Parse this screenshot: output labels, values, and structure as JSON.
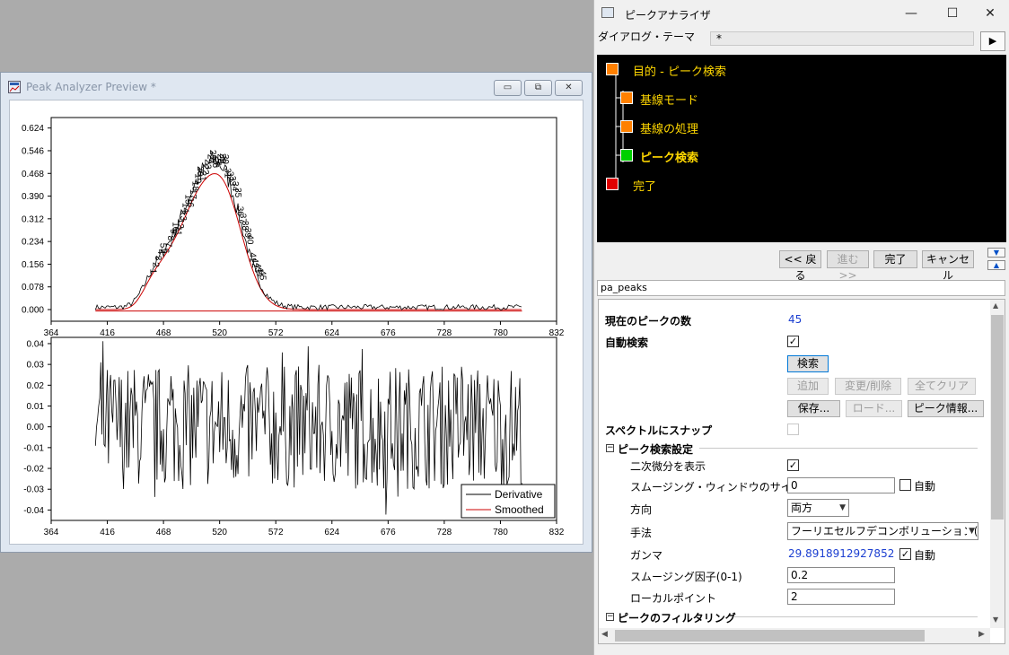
{
  "preview": {
    "title": "Peak Analyzer Preview *",
    "controls": {
      "minimize": "▭",
      "restore": "⧉",
      "close": "✕"
    },
    "top_plot": {
      "x_ticks": [
        "364",
        "416",
        "468",
        "520",
        "572",
        "624",
        "676",
        "728",
        "780",
        "832"
      ],
      "y_ticks": [
        "0.624",
        "0.546",
        "0.468",
        "0.390",
        "0.312",
        "0.234",
        "0.156",
        "0.078",
        "0.000"
      ]
    },
    "bottom_plot": {
      "x_ticks": [
        "364",
        "416",
        "468",
        "520",
        "572",
        "624",
        "676",
        "728",
        "780",
        "832"
      ],
      "y_ticks": [
        "0.04",
        "0.03",
        "0.02",
        "0.01",
        "0.00",
        "-0.01",
        "-0.02",
        "-0.03",
        "-0.04"
      ],
      "legend": [
        {
          "label": "Derivative",
          "color": "#000000"
        },
        {
          "label": "Smoothed",
          "color": "#cc0000"
        }
      ]
    }
  },
  "dialog": {
    "title": "ピークアナライザ",
    "controls": {
      "minimize": "—",
      "maximize": "☐",
      "close": "✕"
    },
    "theme_label": "ダイアログ・テーマ",
    "theme_value": "*",
    "theme_go": "▶",
    "steps": [
      {
        "label": "目的 - ピーク検索",
        "color": "#ff8000"
      },
      {
        "label": "基線モード",
        "color": "#ff8000"
      },
      {
        "label": "基線の処理",
        "color": "#ff8000"
      },
      {
        "label": "ピーク検索",
        "color": "#00d000"
      },
      {
        "label": "完了",
        "color": "#e00000"
      }
    ],
    "nav": {
      "back": "<< 戻る",
      "next": "進む >>",
      "finish": "完了",
      "cancel": "キャンセル"
    },
    "side_up": "▼",
    "side_down": "▲",
    "name": "pa_peaks",
    "props": {
      "peak_count_label": "現在のピークの数",
      "peak_count": "45",
      "auto_find_label": "自動検索",
      "find_btn": "検索",
      "add_btn": "追加",
      "modify_btn": "変更/削除",
      "clear_btn": "全てクリア",
      "save_btn": "保存...",
      "load_btn": "ロード...",
      "info_btn": "ピーク情報...",
      "snap_label": "スペクトルにスナップ",
      "section_find": "ピーク検索設定",
      "show_2nd_label": "二次微分を表示",
      "smooth_window_label": "スムージング・ウィンドウのサイズ",
      "smooth_window_value": "0",
      "auto_label": "自動",
      "direction_label": "方向",
      "direction_value": "両方",
      "method_label": "手法",
      "method_value": "フーリエセルフデコンボリューション(Pr",
      "gamma_label": "ガンマ",
      "gamma_value": "29.8918912927852",
      "gamma_auto_label": "自動",
      "smooth_factor_label": "スムージング因子(0-1)",
      "smooth_factor_value": "0.2",
      "local_points_label": "ローカルポイント",
      "local_points_value": "2",
      "section_filter": "ピークのフィルタリング"
    }
  }
}
